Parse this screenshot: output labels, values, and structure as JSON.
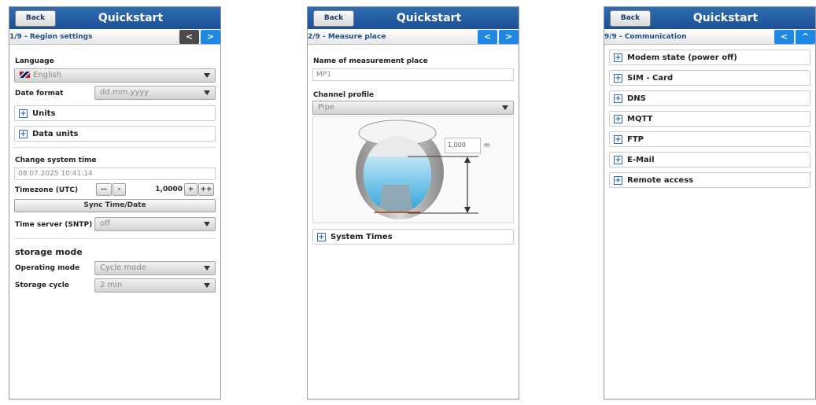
{
  "common": {
    "back_label": "Back",
    "title": "Quickstart",
    "prev_icon": "<",
    "next_icon": ">",
    "up_icon": "^"
  },
  "screen1": {
    "step": "1/9 - Region settings",
    "language_label": "Language",
    "language_value": "English",
    "date_format_label": "Date format",
    "date_format_value": "dd.mm.yyyy",
    "units_label": "Units",
    "data_units_label": "Data units",
    "change_time_label": "Change system time",
    "system_time_value": "08.07.2025 10:41:14",
    "timezone_label": "Timezone (UTC)",
    "tz_minus2": "--",
    "tz_minus1": "-",
    "timezone_value": "1,0000",
    "tz_plus1": "+",
    "tz_plus2": "++",
    "sync_label": "Sync Time/Date",
    "time_server_label": "Time server (SNTP)",
    "time_server_value": "off",
    "storage_mode_heading": "storage mode",
    "operating_mode_label": "Operating mode",
    "operating_mode_value": "Cycle mode",
    "storage_cycle_label": "Storage cycle",
    "storage_cycle_value": "2 min"
  },
  "screen2": {
    "step": "2/9 - Measure place",
    "name_label": "Name of measurement place",
    "name_value": "MP1",
    "channel_profile_label": "Channel profile",
    "channel_profile_value": "Pipe",
    "dimension_value": "1,000",
    "dimension_unit": "m",
    "system_times_label": "System Times"
  },
  "screen3": {
    "step": "9/9 - Communication",
    "items": [
      "Modem state (power off)",
      "SIM - Card",
      "DNS",
      "MQTT",
      "FTP",
      "E-Mail",
      "Remote access"
    ]
  },
  "colors": {
    "header": "#2f6db4",
    "step_text": "#1e4f94",
    "nav_active": "#1e88e5",
    "nav_dark": "#4a4a4a"
  }
}
